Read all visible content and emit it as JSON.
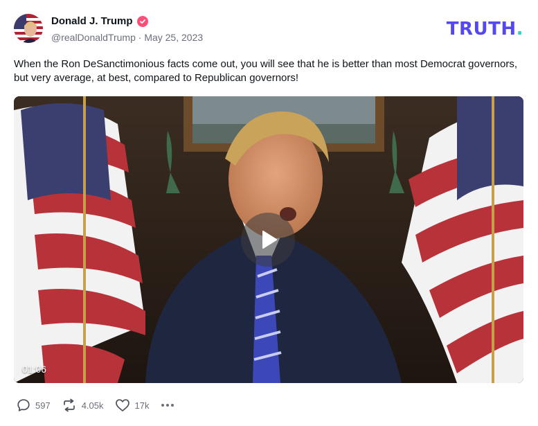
{
  "post": {
    "author": {
      "display_name": "Donald J. Trump",
      "handle": "@realDonaldTrump",
      "date": "May 25, 2023",
      "verified": true,
      "verified_color": "#ff4f78"
    },
    "text": "When the Ron DeSanctimonious facts come out, you will see that he is better than most Democrat governors, but very average, at best, compared to Republican governors!",
    "media": {
      "type": "video",
      "duration": "01:06",
      "play_icon": "play-icon"
    },
    "stats": {
      "replies": "597",
      "retruths": "4.05k",
      "likes": "17k"
    }
  },
  "brand": {
    "logo_text": "TRUTH",
    "logo_dot": ".",
    "logo_color": "#5448ee",
    "dot_color": "#2ad4c2"
  },
  "icons": {
    "reply": "comment-icon",
    "retruth": "repost-icon",
    "like": "heart-icon",
    "more": "more-dots-icon"
  }
}
